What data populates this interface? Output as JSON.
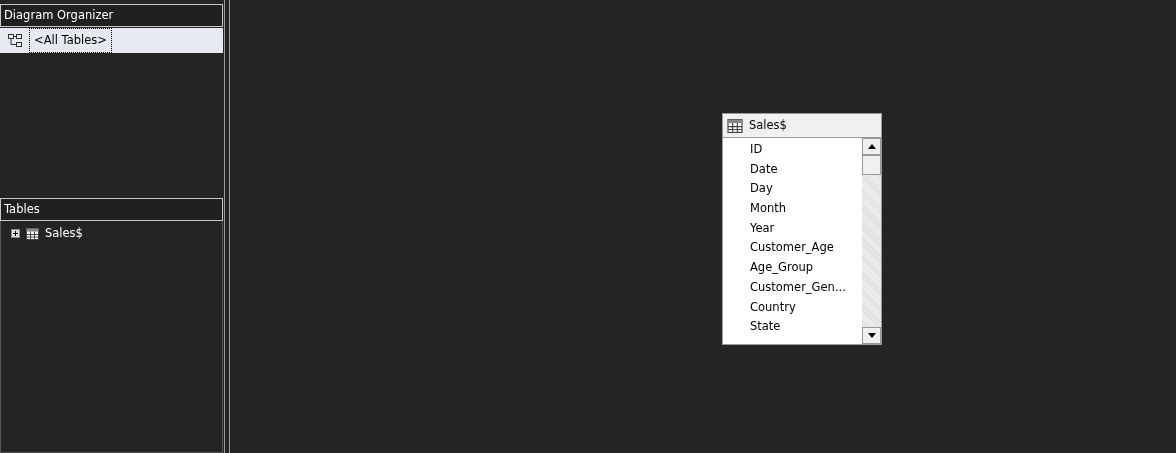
{
  "diagram_organizer": {
    "title": "Diagram Organizer",
    "items": [
      {
        "label": "<All Tables>",
        "selected": true
      }
    ]
  },
  "tables_panel": {
    "title": "Tables",
    "items": [
      {
        "label": "Sales$",
        "expanded": false
      }
    ]
  },
  "diagram": {
    "tables": [
      {
        "name": "Sales$",
        "columns": [
          "ID",
          "Date",
          "Day",
          "Month",
          "Year",
          "Customer_Age",
          "Age_Group",
          "Customer_Gen...",
          "Country",
          "State"
        ]
      }
    ]
  }
}
